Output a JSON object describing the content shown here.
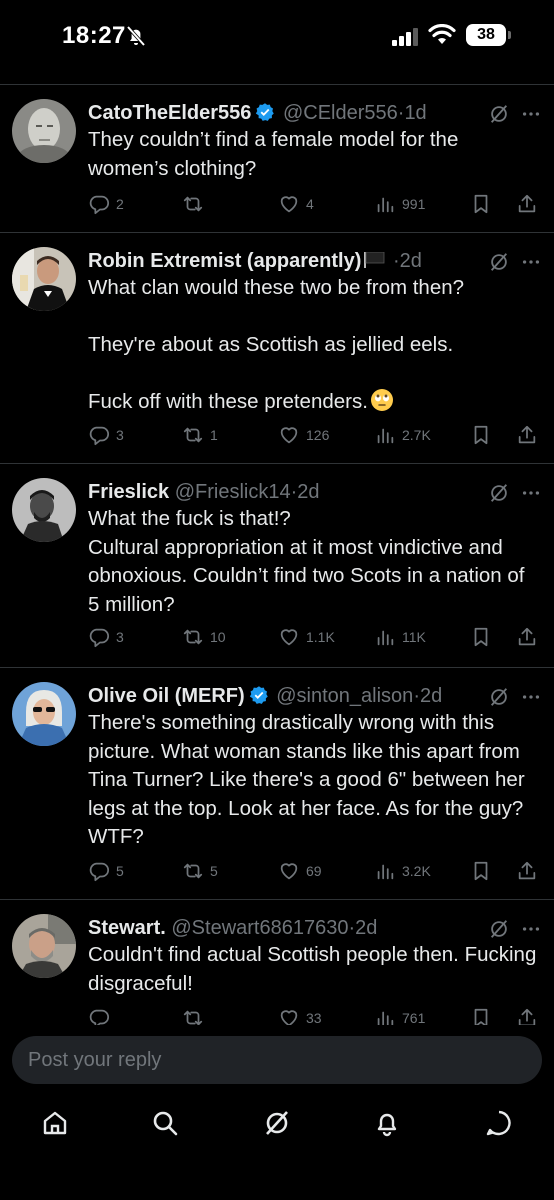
{
  "status_bar": {
    "time": "18:27",
    "battery": "38"
  },
  "tweets": [
    {
      "name": "CatoTheElder556",
      "handle": "@CElder556",
      "sep": "·",
      "time": "1d",
      "verified": true,
      "text": "They couldn’t find a female model for the women’s clothing?",
      "replies": "2",
      "retweets": "",
      "likes": "4",
      "views": "991"
    },
    {
      "name": "Robin Extremist (apparently)",
      "handle": "",
      "sep": "·",
      "time": "2d",
      "verified": false,
      "text": "What clan would these two be from then?\n\nThey're about as Scottish as jellied eels.\n\nFuck off with these pretenders.",
      "replies": "3",
      "retweets": "1",
      "likes": "126",
      "views": "2.7K"
    },
    {
      "name": "Frieslick",
      "handle": "@Frieslick14",
      "sep": "·",
      "time": "2d",
      "verified": false,
      "text": "What the fuck is that!?\nCultural appropriation at it most vindictive and obnoxious. Couldn’t find two Scots in a nation of 5 million?",
      "replies": "3",
      "retweets": "10",
      "likes": "1.1K",
      "views": "11K"
    },
    {
      "name": "Olive Oil (MERF)",
      "handle": "@sinton_alison",
      "sep": "·",
      "time": "2d",
      "verified": true,
      "text": "There's something drastically wrong with this picture. What woman stands like this apart from Tina Turner? Like there's a good 6\" between her legs at the top. Look at her face. As for the guy? WTF?",
      "replies": "5",
      "retweets": "5",
      "likes": "69",
      "views": "3.2K"
    },
    {
      "name": "Stewart.",
      "handle": "@Stewart68617630",
      "sep": "·",
      "time": "2d",
      "verified": false,
      "text": "Couldn't find actual Scottish people then. Fucking disgraceful!",
      "replies": "",
      "retweets": "",
      "likes": "33",
      "views": "761"
    }
  ],
  "reply_box": {
    "placeholder": "Post your reply"
  },
  "colors": {
    "background": "#000000",
    "text": "#e7e9ea",
    "muted": "#71767b",
    "verified": "#1d9bf0",
    "divider": "#2f3336"
  },
  "icons": [
    "reply-icon",
    "retweet-icon",
    "like-icon",
    "views-icon",
    "bookmark-icon",
    "share-icon",
    "grok-icon",
    "more-icon",
    "home-icon",
    "search-icon",
    "bell-icon",
    "messages-icon"
  ]
}
